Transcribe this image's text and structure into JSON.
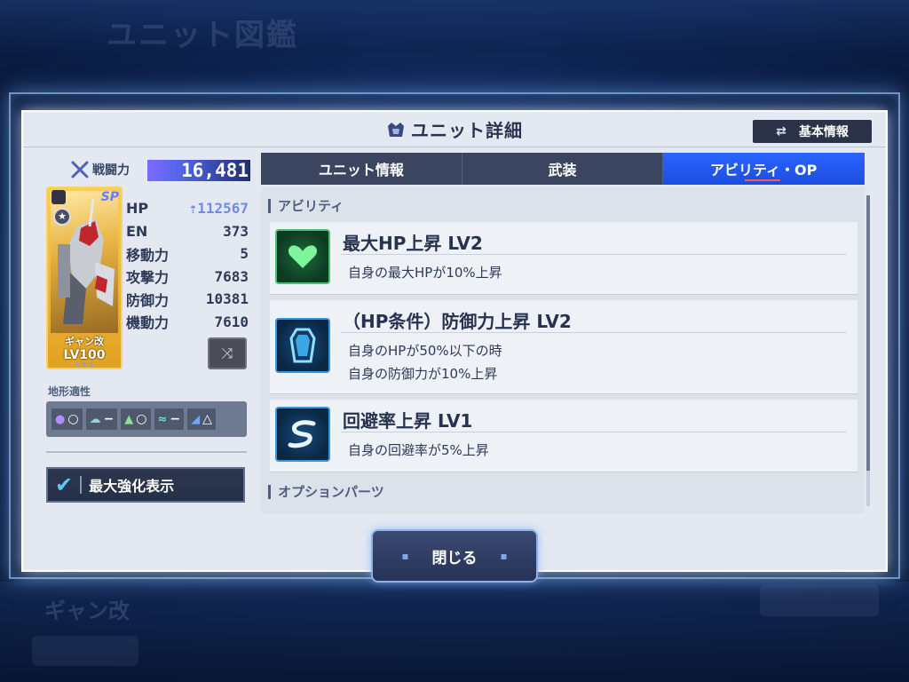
{
  "background": {
    "title": "ユニット図鑑",
    "unit_name": "ギャン改"
  },
  "header": {
    "title": "ユニット詳細",
    "basic_info_label": "基本情報"
  },
  "left": {
    "power_label": "戦闘力",
    "power_value": "16,481",
    "card": {
      "badge": "SP",
      "name": "ギャン改",
      "level": "LV100",
      "stars": "★★★"
    },
    "stats": [
      {
        "label": "HP",
        "value": "112567"
      },
      {
        "label": "EN",
        "value": "373"
      },
      {
        "label": "移動力",
        "value": "5"
      },
      {
        "label": "攻撃力",
        "value": "7683"
      },
      {
        "label": "防御力",
        "value": "10381"
      },
      {
        "label": "機動力",
        "value": "7610"
      }
    ],
    "terrain_label": "地形適性",
    "terrain": [
      {
        "icon": "space-icon",
        "rank": "○"
      },
      {
        "icon": "air-icon",
        "rank": "−"
      },
      {
        "icon": "land-icon",
        "rank": "○"
      },
      {
        "icon": "water-icon",
        "rank": "−"
      },
      {
        "icon": "underwater-icon",
        "rank": "△"
      }
    ],
    "max_enhance_label": "最大強化表示"
  },
  "tabs": [
    {
      "label": "ユニット情報",
      "active": false
    },
    {
      "label": "武装",
      "active": false
    },
    {
      "label": "アビリティ・OP",
      "active": true
    }
  ],
  "content": {
    "ability_section": "アビリティ",
    "abilities": [
      {
        "name": "最大HP上昇 LV2",
        "icon": "heart-icon",
        "lines": [
          "自身の最大HPが10%上昇"
        ]
      },
      {
        "name": "（HP条件）防御力上昇 LV2",
        "icon": "shield-icon",
        "lines": [
          "自身のHPが50%以下の時",
          "自身の防御力が10%上昇"
        ]
      },
      {
        "name": "回避率上昇 LV1",
        "icon": "evasion-icon",
        "lines": [
          "自身の回避率が5%上昇"
        ]
      }
    ],
    "option_section": "オプションパーツ"
  },
  "footer": {
    "close_label": "閉じる"
  },
  "colors": {
    "accent": "#2b64ff",
    "panel": "#e4e9f1",
    "header_dark": "#3b4560",
    "frame_glow": "#aad2ff"
  }
}
